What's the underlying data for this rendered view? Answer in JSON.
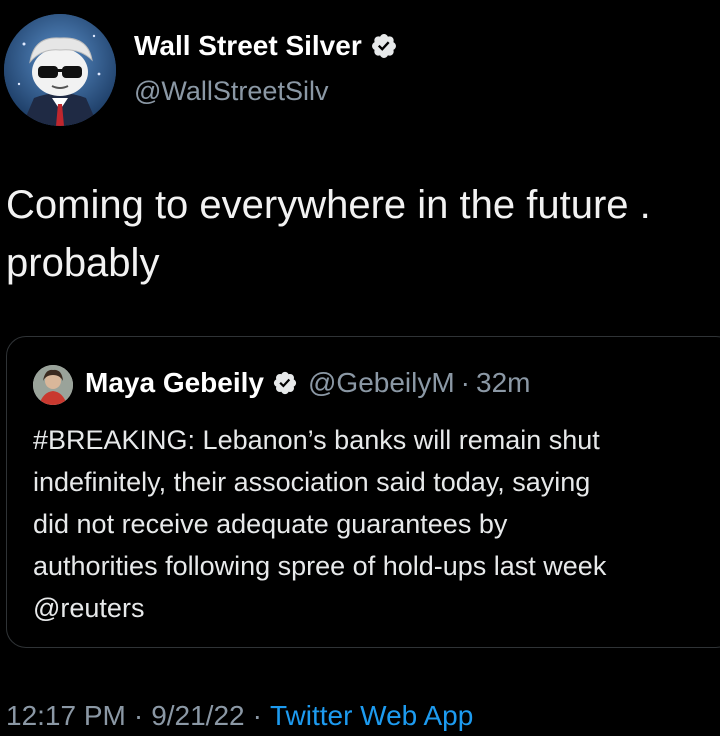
{
  "tweet": {
    "author_name": "Wall Street Silver",
    "author_handle": "@WallStreetSilv",
    "verified_icon": "verified-badge-icon",
    "text_line1": "Coming to everywhere in the future .",
    "text_line2": "probably"
  },
  "quote": {
    "author_name": "Maya Gebeily",
    "author_handle": "@GebeilyM",
    "separator": "·",
    "time": "32m",
    "lines": [
      "#BREAKING: Lebanon’s banks will remain shut",
      "indefinitely, their association said today, saying",
      "did not receive adequate guarantees by",
      "authorities following spree of hold-ups last week",
      "@reuters"
    ]
  },
  "meta": {
    "time": "12:17 PM",
    "separator": "·",
    "date": "9/21/22",
    "source": "Twitter Web App"
  },
  "colors": {
    "background": "#000000",
    "text": "#e7e9ea",
    "secondary": "#8b98a5",
    "link": "#1d9bf0",
    "border": "#2f3336"
  }
}
